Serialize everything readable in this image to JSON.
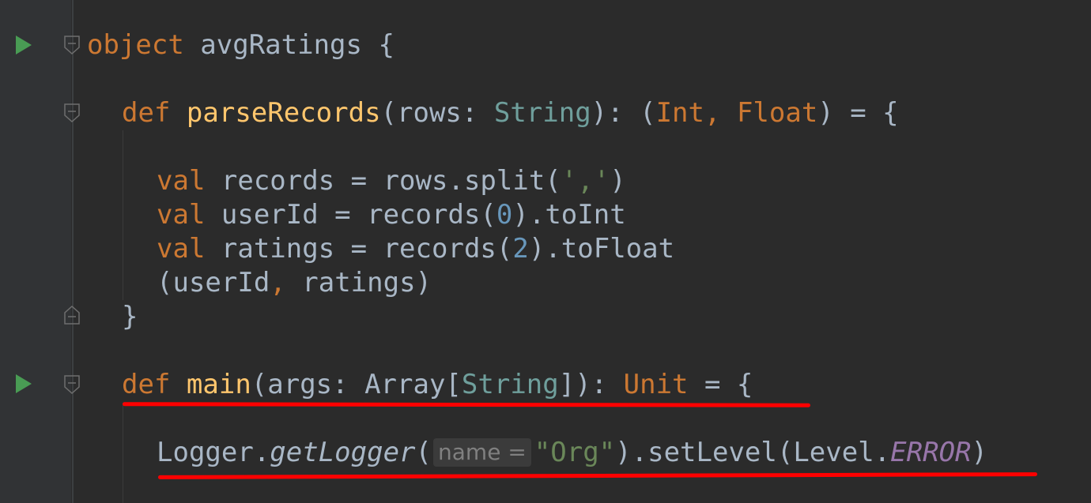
{
  "gutter": {
    "run_icon": "run-triangle-icon",
    "fold_icon": "fold-marker-icon"
  },
  "code": {
    "line1": {
      "kw": "object",
      "name": " avgRatings ",
      "brace": "{"
    },
    "line2": {
      "kw": "def",
      "fn": "parseRecords",
      "p1": "(rows: ",
      "t1": "String",
      "p2": "): (",
      "t2": "Int",
      "comma": ", ",
      "t3": "Float",
      "p3": ") = {"
    },
    "line3": {
      "kw": "val",
      "rest": " records = rows.split(",
      "str": "','",
      "close": ")"
    },
    "line4": {
      "kw": "val",
      "rest": " userId = records(",
      "num": "0",
      "close": ").toInt"
    },
    "line5": {
      "kw": "val",
      "rest": " ratings = records(",
      "num": "2",
      "close": ").toFloat"
    },
    "line6": {
      "open": "(userId",
      "comma": ", ",
      "close": "ratings)"
    },
    "line7": {
      "brace": "}"
    },
    "line8": {
      "kw": "def",
      "fn": "main",
      "p1": "(args: Array[",
      "t1": "String",
      "p2": "]): ",
      "kw2": "Unit",
      "p3": " = {"
    },
    "line9": {
      "obj": "Logger.",
      "method": "getLogger",
      "open": "(",
      "hint": "name =",
      "str": "\"Org\"",
      "mid": ").setLevel(Level.",
      "const": "ERROR",
      "close": ")"
    }
  },
  "colors": {
    "background": "#2b2b2b",
    "keyword": "#cc7832",
    "function": "#ffc66d",
    "type": "#6f9f9c",
    "string": "#6a8759",
    "number": "#6897bb",
    "constant": "#9876aa",
    "text": "#a9b7c6",
    "annotation_underline": "#ff0000"
  }
}
